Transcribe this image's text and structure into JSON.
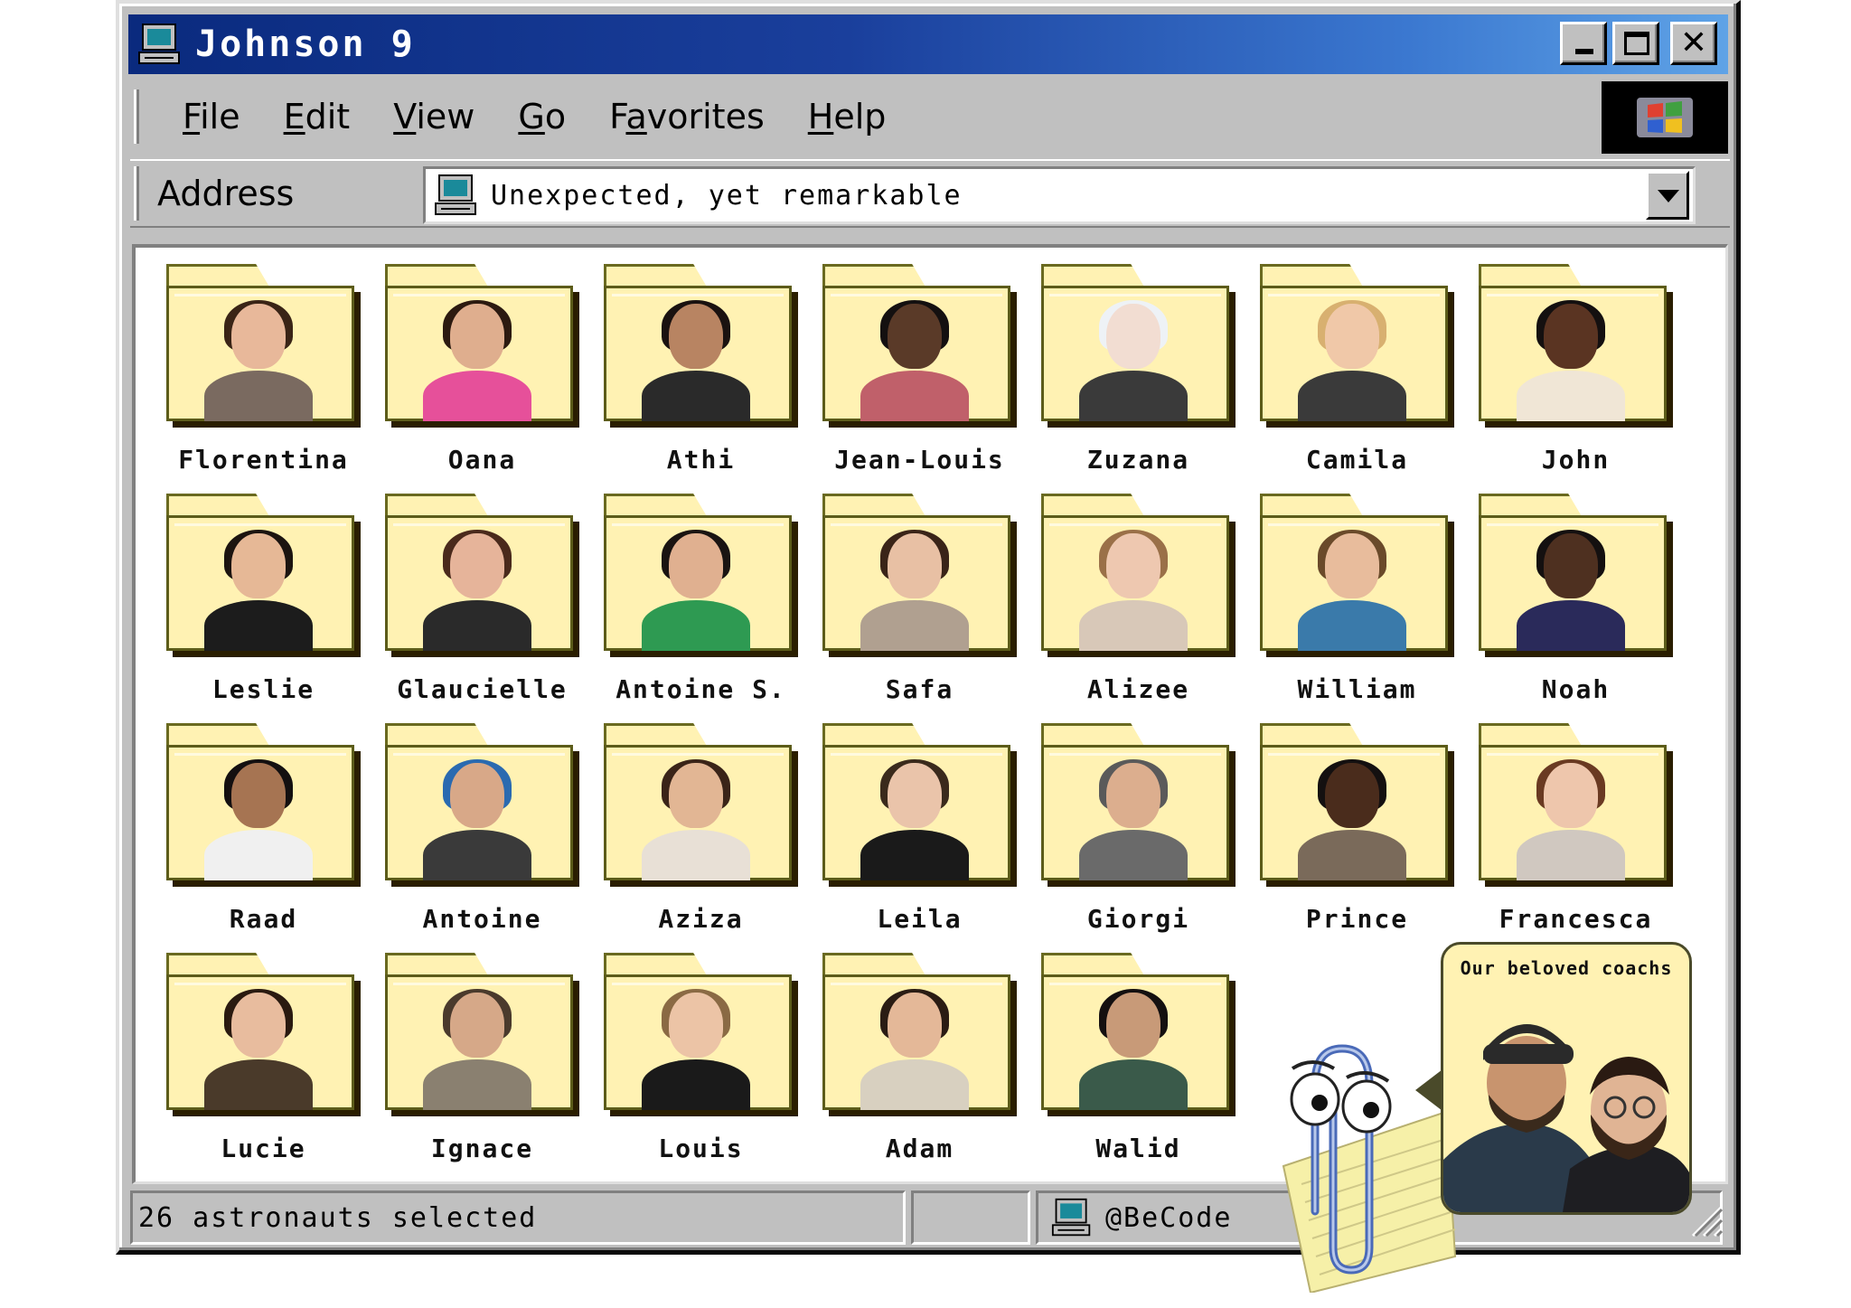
{
  "window": {
    "title": "Johnson 9",
    "title_icon": "computer-icon",
    "controls": {
      "minimize": "minimize-icon",
      "maximize": "maximize-icon",
      "close": "close-icon",
      "close_glyph": "✕"
    }
  },
  "menu": {
    "items": [
      {
        "pre": "",
        "key": "F",
        "post": "ile"
      },
      {
        "pre": "",
        "key": "E",
        "post": "dit"
      },
      {
        "pre": "",
        "key": "V",
        "post": "iew"
      },
      {
        "pre": "",
        "key": "G",
        "post": "o"
      },
      {
        "pre": "F",
        "key": "a",
        "post": "vorites"
      },
      {
        "pre": "",
        "key": "H",
        "post": "elp"
      }
    ],
    "logo_icon": "windows-logo-icon"
  },
  "address": {
    "label": "Address",
    "value": "Unexpected, yet remarkable",
    "icon": "computer-icon"
  },
  "folders": [
    {
      "name": "Florentina",
      "hair": "#3a2416",
      "skin": "#e8b89a",
      "shirt": "#7a6a60"
    },
    {
      "name": "Oana",
      "hair": "#2c1a10",
      "skin": "#dfae8e",
      "shirt": "#e6509a"
    },
    {
      "name": "Athi",
      "hair": "#1a1210",
      "skin": "#b88462",
      "shirt": "#2a2a2a"
    },
    {
      "name": "Jean-Louis",
      "hair": "#141010",
      "skin": "#5a3a28",
      "shirt": "#c0606a"
    },
    {
      "name": "Zuzana",
      "hair": "#eef2f6",
      "skin": "#f2ddd2",
      "shirt": "#3a3a3a"
    },
    {
      "name": "Camila",
      "hair": "#d8b070",
      "skin": "#f0c8a8",
      "shirt": "#3a3a3a"
    },
    {
      "name": "John",
      "hair": "#141010",
      "skin": "#5a3422",
      "shirt": "#f0e6d6"
    },
    {
      "name": "Leslie",
      "hair": "#1c1410",
      "skin": "#e6b896",
      "shirt": "#1c1c1c"
    },
    {
      "name": "Glaucielle",
      "hair": "#4a2a1c",
      "skin": "#e6b49a",
      "shirt": "#2a2a2a"
    },
    {
      "name": "Antoine S.",
      "hair": "#1a1412",
      "skin": "#e0b090",
      "shirt": "#2e9a52"
    },
    {
      "name": "Safa",
      "hair": "#3a2418",
      "skin": "#e8c0a4",
      "shirt": "#b0a090"
    },
    {
      "name": "Alizee",
      "hair": "#9a7048",
      "skin": "#eec8b0",
      "shirt": "#d8c8b8"
    },
    {
      "name": "William",
      "hair": "#6a4a2a",
      "skin": "#e8bc9c",
      "shirt": "#3a7aaa"
    },
    {
      "name": "Noah",
      "hair": "#141010",
      "skin": "#4e3020",
      "shirt": "#2a2a5a"
    },
    {
      "name": "Raad",
      "hair": "#141010",
      "skin": "#a67452",
      "shirt": "#f0f0f0"
    },
    {
      "name": "Antoine",
      "hair": "#2a6ab0",
      "skin": "#d8a888",
      "shirt": "#3a3a3a"
    },
    {
      "name": "Aziza",
      "hair": "#3a2418",
      "skin": "#e2b694",
      "shirt": "#e8e0d6"
    },
    {
      "name": "Leila",
      "hair": "#3a2a1c",
      "skin": "#eac4aa",
      "shirt": "#1a1a1a"
    },
    {
      "name": "Giorgi",
      "hair": "#5a5a5a",
      "skin": "#dcae8e",
      "shirt": "#6a6a6a"
    },
    {
      "name": "Prince",
      "hair": "#141010",
      "skin": "#4a2c1c",
      "shirt": "#7a6a5a"
    },
    {
      "name": "Francesca",
      "hair": "#6a3a22",
      "skin": "#eec6ac",
      "shirt": "#d0c8c0"
    },
    {
      "name": "Lucie",
      "hair": "#2a1a10",
      "skin": "#e8bc9e",
      "shirt": "#4a3a2a"
    },
    {
      "name": "Ignace",
      "hair": "#4a3a2c",
      "skin": "#d6a888",
      "shirt": "#8a8070"
    },
    {
      "name": "Louis",
      "hair": "#8a6a44",
      "skin": "#ecc4a6",
      "shirt": "#1a1a1a"
    },
    {
      "name": "Adam",
      "hair": "#2a1c14",
      "skin": "#e4b898",
      "shirt": "#d8d0c0"
    },
    {
      "name": "Walid",
      "hair": "#141010",
      "skin": "#c89a78",
      "shirt": "#3a5a4a"
    }
  ],
  "status": {
    "selection": "26 astronauts selected",
    "zone_icon": "computer-icon",
    "zone_label": "@BeCode"
  },
  "coaches_bubble": {
    "title": "Our beloved coachs"
  },
  "assistant": {
    "icon": "clippy-paperclip-icon"
  }
}
